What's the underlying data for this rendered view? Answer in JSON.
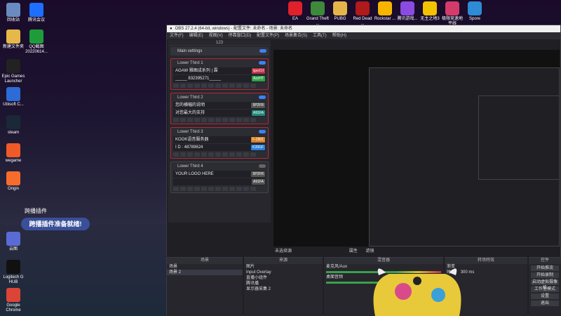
{
  "desktop": {
    "left_icons": [
      {
        "label": "回收站",
        "icon": "recycle-bin-icon",
        "color": "#6a8bbf"
      },
      {
        "label": "腾讯会议",
        "icon": "tencent-meeting-icon",
        "color": "#1e6fff"
      },
      {
        "label": "新建文件夹",
        "icon": "folder-icon",
        "color": "#e6b84a"
      },
      {
        "label": "QQ截图20220614...",
        "icon": "image-file-icon",
        "color": "#1f9c3a"
      },
      {
        "label": "Epic Games Launcher",
        "icon": "epic-icon",
        "color": "#222222"
      },
      {
        "label": "Ubisoft C...",
        "icon": "ubisoft-icon",
        "color": "#2d6bd6"
      },
      {
        "label": "steam",
        "icon": "steam-icon",
        "color": "#1b2838"
      },
      {
        "label": "wegame",
        "icon": "wegame-icon",
        "color": "#f05a28"
      },
      {
        "label": "Origin",
        "icon": "origin-icon",
        "color": "#f56c2d"
      },
      {
        "label": "云图",
        "icon": "cloud-icon",
        "color": "#5b6bd6"
      },
      {
        "label": "Logitech G HUB",
        "icon": "logitech-icon",
        "color": "#111111"
      },
      {
        "label": "Google Chrome",
        "icon": "chrome-icon",
        "color": "#db4437"
      }
    ],
    "top_icons": [
      {
        "label": "EA",
        "icon": "ea-icon",
        "color": "#e0202a"
      },
      {
        "label": "Grand Theft ...",
        "icon": "gta-icon",
        "color": "#3c8a3a"
      },
      {
        "label": "PUBG",
        "icon": "pubg-icon",
        "color": "#e5b54a"
      },
      {
        "label": "Red Dead ...",
        "icon": "rdr-icon",
        "color": "#b01a1a"
      },
      {
        "label": "Rockstar ...",
        "icon": "rockstar-icon",
        "color": "#f7b500"
      },
      {
        "label": "腾讯游戏...",
        "icon": "tencent-games-icon",
        "color": "#8a4be0"
      },
      {
        "label": "无主之地3",
        "icon": "borderlands-icon",
        "color": "#f2c200"
      },
      {
        "label": "极限竞速地平线",
        "icon": "forza-icon",
        "color": "#d43b6b"
      },
      {
        "label": "Spore",
        "icon": "spore-icon",
        "color": "#2e8bd6"
      }
    ]
  },
  "obs": {
    "title": "OBS 27.2.4 (64-bit, windows) - 配置文件: 未命名 - 场景: 未命名",
    "menu": [
      "文件(F)",
      "编辑(E)",
      "视图(V)",
      "停靠窗口(D)",
      "配置文件(P)",
      "场景集合(S)",
      "工具(T)",
      "帮助(H)"
    ],
    "lt_panel": {
      "header": "123",
      "main_settings": "Main settings",
      "cards": [
        {
          "title": "Lower Third 1",
          "active": true,
          "row1": "AGAW 雅图成系列 | 霖",
          "tag1": "lgssCrl",
          "tag1_color": "#c0334a",
          "row2": "_____ 832395271_____",
          "tag2": "AzzHT",
          "tag2_color": "#2fa04a"
        },
        {
          "title": "Lower Third 2",
          "active": true,
          "row1": "您的横幅的说明",
          "tag1": "5P2FR",
          "tag1_color": "#555555",
          "row2": "对您最大的支持",
          "tag2": "A91FA",
          "tag2_color": "#1f8a7a"
        },
        {
          "title": "Lower Third 3",
          "active": true,
          "row1": "KOOK语音服务器",
          "tag1": "F-2901",
          "tag1_color": "#d9822b",
          "row2": "I D : 48789624",
          "tag2": "K39GF",
          "tag2_color": "#2b7fd9"
        },
        {
          "title": "Lower Third 4",
          "active": false,
          "row1": "YOUR LOGO HERE",
          "tag1": "5P2FR",
          "tag1_color": "#555555",
          "row2": "",
          "tag2": "A91FA",
          "tag2_color": "#555555"
        }
      ]
    },
    "status": {
      "no_source": "未选择源",
      "props": "属性",
      "filters": "滤镜"
    },
    "docks": {
      "scenes": {
        "title": "场景",
        "items": [
          "场景",
          "场景 2"
        ],
        "selected": 1
      },
      "sources": {
        "title": "来源",
        "items": [
          "图片",
          "Input Overlay",
          "直播小组件",
          "腾讯播",
          "显示器采集 2"
        ]
      },
      "mixer": {
        "title": "混音器",
        "items": [
          "麦克风/Aux",
          "桌面音频"
        ]
      },
      "transitions": {
        "title": "转场特效",
        "type": "渐变",
        "duration_label": "时长",
        "duration": "300 ms"
      },
      "controls": {
        "title": "控件",
        "buttons": [
          "开始推流",
          "开始录制",
          "启动虚拟摄像机",
          "工作室模式",
          "设置",
          "退出"
        ]
      }
    }
  },
  "toast": {
    "title": "跨播插件",
    "message": "跨播插件准备就绪!"
  }
}
